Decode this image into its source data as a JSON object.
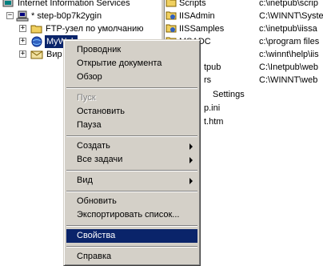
{
  "tree": {
    "root_label": "Internet Information Services",
    "server_label": "* step-b0p7k2ygin",
    "ftp_label": "FTP-узел по умолчанию",
    "selected_label": "MyWeb",
    "virtual_label": "Вир"
  },
  "list": {
    "rows": [
      {
        "name": "Scripts",
        "path": "c:\\inetpub\\scrip"
      },
      {
        "name": "IISAdmin",
        "path": "C:\\WINNT\\Syste"
      },
      {
        "name": "IISSamples",
        "path": "c:\\inetpub\\iissa"
      },
      {
        "name": "MSADC",
        "path": "c:\\program files"
      },
      {
        "name": "",
        "path": "c:\\winnt\\help\\iis"
      },
      {
        "name": "tpub",
        "path": "C:\\Inetpub\\web"
      },
      {
        "name": "rs",
        "path": "C:\\WINNT\\web"
      },
      {
        "name": "Settings",
        "path": ""
      },
      {
        "name": "p.ini",
        "path": ""
      },
      {
        "name": "t.htm",
        "path": ""
      }
    ]
  },
  "menu": {
    "explorer": "Проводник",
    "open_doc": "Открытие документа",
    "browse": "Обзор",
    "start": "Пуск",
    "stop": "Остановить",
    "pause": "Пауза",
    "create": "Создать",
    "all_tasks": "Все задачи",
    "view": "Вид",
    "refresh": "Обновить",
    "export": "Экспортировать список...",
    "properties": "Свойства",
    "help": "Справка"
  },
  "colors": {
    "selection": "#0a246a",
    "menu_face": "#d4d0c8"
  }
}
